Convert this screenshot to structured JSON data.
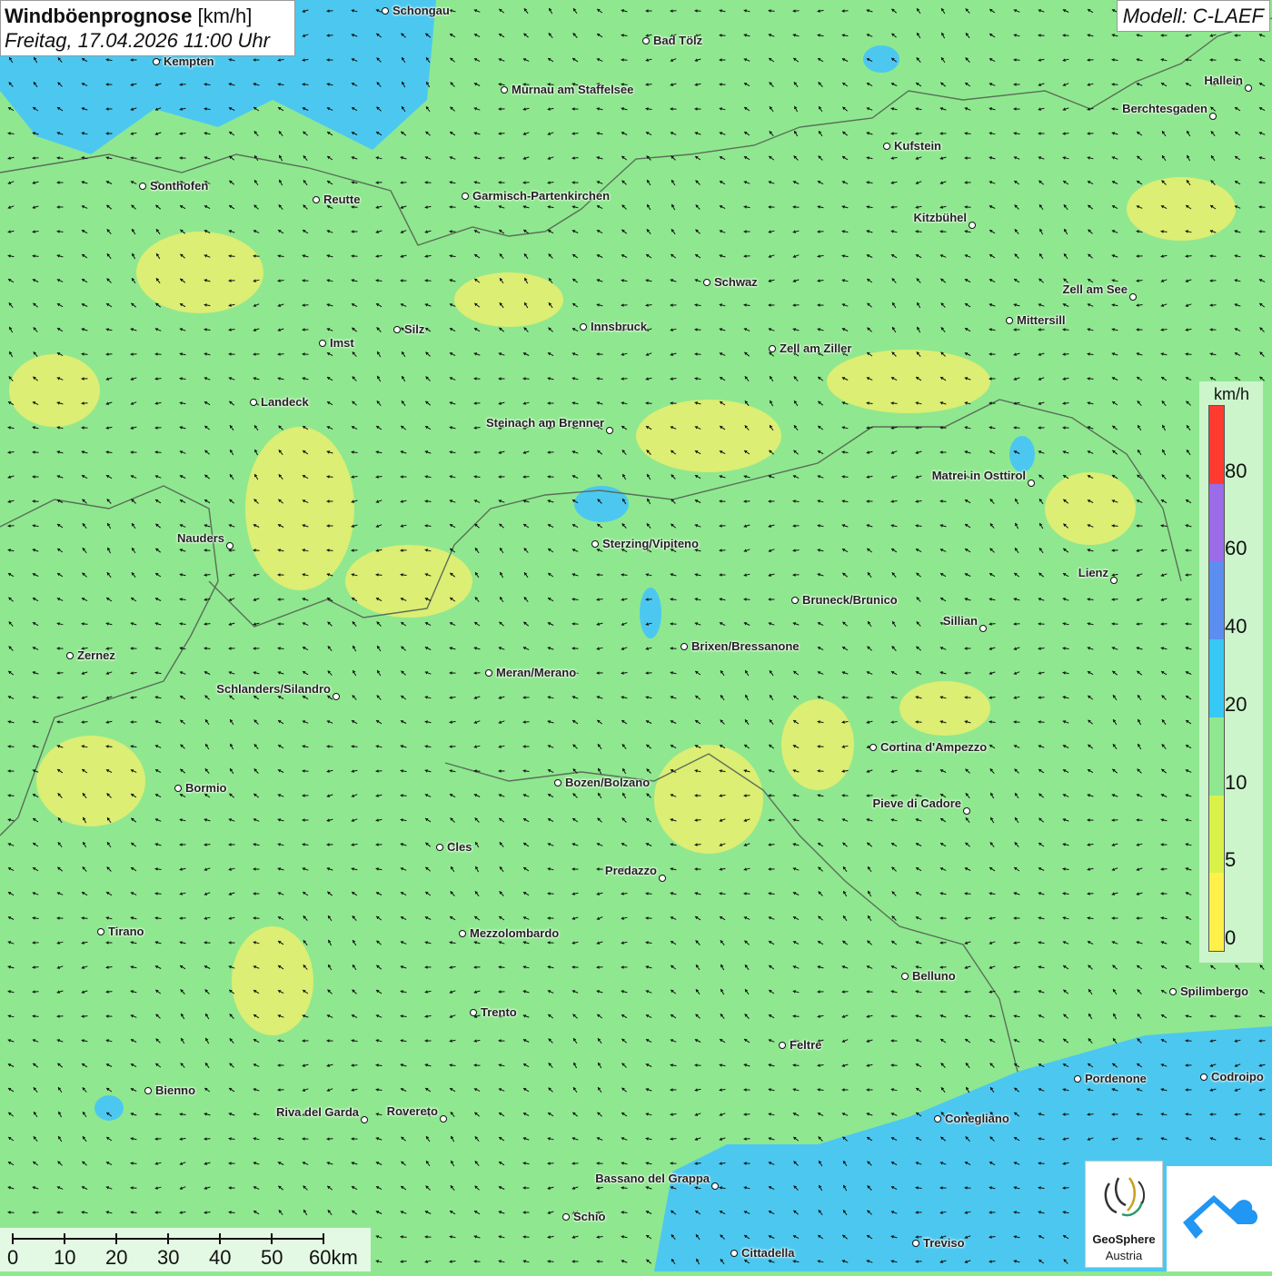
{
  "header": {
    "title_bold": "Windböenprognose",
    "title_unit": " [km/h]",
    "subtitle": "Freitag, 17.04.2026 11:00 Uhr",
    "model": "Modell: C-LAEF"
  },
  "cities": [
    {
      "name": "Schongau"
    },
    {
      "name": "Bad Tölz"
    },
    {
      "name": "Kempten"
    },
    {
      "name": "Murnau am Staffelsee"
    },
    {
      "name": "Hallein"
    },
    {
      "name": "Berchtesgaden"
    },
    {
      "name": "Kufstein"
    },
    {
      "name": "Sonthofen"
    },
    {
      "name": "Reutte"
    },
    {
      "name": "Garmisch-Partenkirchen"
    },
    {
      "name": "Kitzbühel"
    },
    {
      "name": "Schwaz"
    },
    {
      "name": "Zell am See"
    },
    {
      "name": "Mittersill"
    },
    {
      "name": "Silz"
    },
    {
      "name": "Innsbruck"
    },
    {
      "name": "Imst"
    },
    {
      "name": "Zell am Ziller"
    },
    {
      "name": "Landeck"
    },
    {
      "name": "Steinach am Brenner"
    },
    {
      "name": "Matrei in Osttirol"
    },
    {
      "name": "Nauders"
    },
    {
      "name": "Sterzing/Vipiteno"
    },
    {
      "name": "Lienz"
    },
    {
      "name": "Bruneck/Brunico"
    },
    {
      "name": "Sillian"
    },
    {
      "name": "Zernez"
    },
    {
      "name": "Brixen/Bressanone"
    },
    {
      "name": "Meran/Merano"
    },
    {
      "name": "Schlanders/Silandro"
    },
    {
      "name": "Cortina d'Ampezzo"
    },
    {
      "name": "Bozen/Bolzano"
    },
    {
      "name": "Bormio"
    },
    {
      "name": "Pieve di Cadore"
    },
    {
      "name": "Cles"
    },
    {
      "name": "Predazzo"
    },
    {
      "name": "Tirano"
    },
    {
      "name": "Mezzolombardo"
    },
    {
      "name": "Belluno"
    },
    {
      "name": "Spilimbergo"
    },
    {
      "name": "Trento"
    },
    {
      "name": "Feltre"
    },
    {
      "name": "Pordenone"
    },
    {
      "name": "Codroipo"
    },
    {
      "name": "Bienno"
    },
    {
      "name": "Riva del Garda"
    },
    {
      "name": "Rovereto"
    },
    {
      "name": "Conegliano"
    },
    {
      "name": "Bassano del Grappa"
    },
    {
      "name": "Schio"
    },
    {
      "name": "Treviso"
    },
    {
      "name": "Cittadella"
    }
  ],
  "legend": {
    "unit": "km/h",
    "ticks": [
      "80",
      "60",
      "40",
      "20",
      "10",
      "5",
      "0"
    ],
    "colors": [
      "#ff3b30",
      "#9b6be8",
      "#5b8ef0",
      "#38c8f5",
      "#8fe88f",
      "#d8f24a",
      "#fff04a"
    ]
  },
  "scale": {
    "labels": [
      "0",
      "10",
      "20",
      "30",
      "40",
      "50",
      "60km"
    ]
  },
  "logos": {
    "geosphere_line1": "GeoSphere",
    "geosphere_line2": "Austria"
  },
  "map_colors": {
    "background": "#8fe88f",
    "low_wind": "#f6f06a",
    "strong_wind": "#4cc8f0",
    "border": "#5a6e5a",
    "arrow": "#111111"
  }
}
